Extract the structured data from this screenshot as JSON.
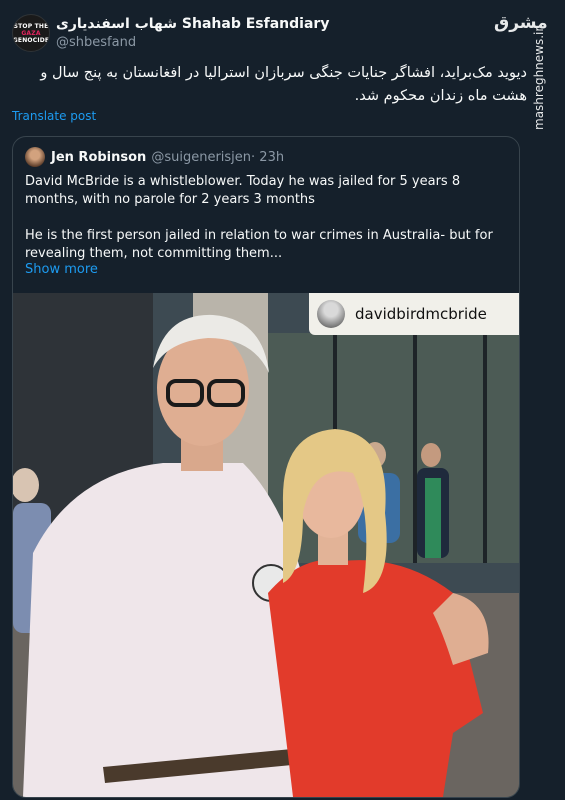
{
  "author": {
    "avatar_lines": [
      "STOP THE",
      "GAZA",
      "GENOCIDE"
    ],
    "name": "شهاب اسفندیاری Shahab Esfandiary",
    "handle": "@shbesfand"
  },
  "brand": {
    "logo_text": "مشرق",
    "watermark": "mashreghnews.ir"
  },
  "tweet": {
    "text": "دیوید مک‌براید، افشاگر جنایات جنگی سربازان استرالیا در افغانستان به پنج سال و هشت ماه زندان محکوم شد.",
    "translate_label": "Translate post"
  },
  "quote": {
    "name": "Jen Robinson",
    "handle": "@suigenerisjen",
    "time": "· 23h",
    "para1": "David McBride is a whistleblower. Today he was jailed for 5 years 8 months, with no parole for 2 years 3 months",
    "para2": "He is the first person jailed in relation to war crimes in Australia- but for revealing them, not committing them...",
    "show_more": "Show more",
    "photo_tag": "davidbirdmcbride"
  }
}
